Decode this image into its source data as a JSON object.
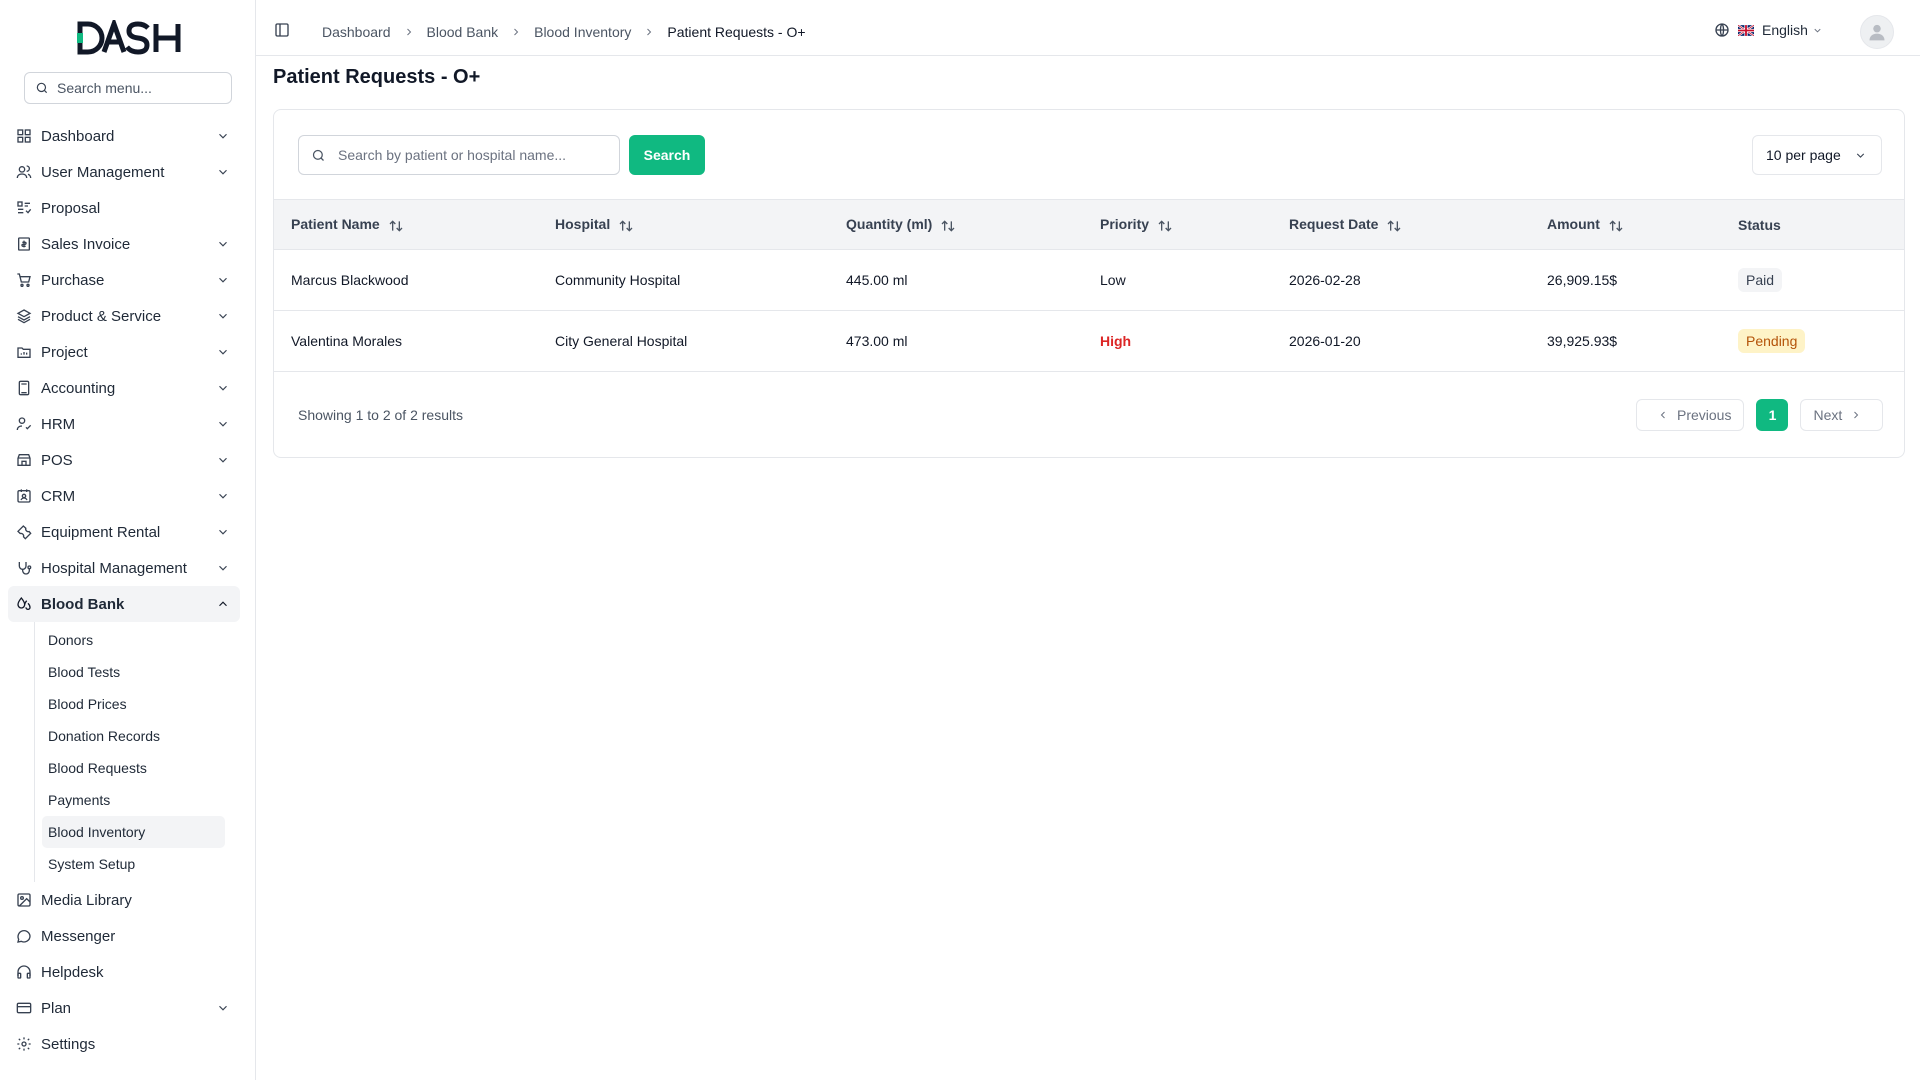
{
  "sidebar": {
    "search_placeholder": "Search menu...",
    "items": [
      {
        "label": "Dashboard",
        "icon": "grid-icon",
        "chevron": true
      },
      {
        "label": "User Management",
        "icon": "users-icon",
        "chevron": true
      },
      {
        "label": "Proposal",
        "icon": "list-icon",
        "chevron": false
      },
      {
        "label": "Sales Invoice",
        "icon": "invoice-icon",
        "chevron": true
      },
      {
        "label": "Purchase",
        "icon": "cart-icon",
        "chevron": true
      },
      {
        "label": "Product & Service",
        "icon": "layers-icon",
        "chevron": true
      },
      {
        "label": "Project",
        "icon": "folder-icon",
        "chevron": true
      },
      {
        "label": "Accounting",
        "icon": "calculator-icon",
        "chevron": true
      },
      {
        "label": "HRM",
        "icon": "hrm-icon",
        "chevron": true
      },
      {
        "label": "POS",
        "icon": "store-icon",
        "chevron": true
      },
      {
        "label": "CRM",
        "icon": "crm-icon",
        "chevron": true
      },
      {
        "label": "Equipment Rental",
        "icon": "wrench-icon",
        "chevron": true
      },
      {
        "label": "Hospital Management",
        "icon": "stethoscope-icon",
        "chevron": true
      },
      {
        "label": "Blood Bank",
        "icon": "blood-drop-icon",
        "chevron": true
      }
    ],
    "blood_bank_sub": [
      "Donors",
      "Blood Tests",
      "Blood Prices",
      "Donation Records",
      "Blood Requests",
      "Payments",
      "Blood Inventory",
      "System Setup"
    ],
    "bottom_items": [
      {
        "label": "Media Library",
        "icon": "image-icon",
        "chevron": false
      },
      {
        "label": "Messenger",
        "icon": "message-icon",
        "chevron": false
      },
      {
        "label": "Helpdesk",
        "icon": "headphones-icon",
        "chevron": false
      },
      {
        "label": "Plan",
        "icon": "card-icon",
        "chevron": true
      },
      {
        "label": "Settings",
        "icon": "gear-icon",
        "chevron": false
      }
    ]
  },
  "header": {
    "breadcrumbs": [
      "Dashboard",
      "Blood Bank",
      "Blood Inventory",
      "Patient Requests - O+"
    ],
    "language": "English"
  },
  "page": {
    "title": "Patient Requests - O+",
    "search_placeholder": "Search by patient or hospital name...",
    "search_button": "Search",
    "per_page": "10 per page"
  },
  "table": {
    "columns": [
      "Patient Name",
      "Hospital",
      "Quantity (ml)",
      "Priority",
      "Request Date",
      "Amount",
      "Status"
    ],
    "rows": [
      {
        "patient": "Marcus Blackwood",
        "hospital": "Community Hospital",
        "quantity": "445.00 ml",
        "priority": "Low",
        "date": "2026-02-28",
        "amount": "26,909.15$",
        "status": "Paid"
      },
      {
        "patient": "Valentina Morales",
        "hospital": "City General Hospital",
        "quantity": "473.00 ml",
        "priority": "High",
        "date": "2026-01-20",
        "amount": "39,925.93$",
        "status": "Pending"
      }
    ]
  },
  "footer": {
    "showing": "Showing 1 to 2 of 2 results",
    "previous": "Previous",
    "page": "1",
    "next": "Next"
  },
  "colors": {
    "accent": "#10b981",
    "high": "#dc2626",
    "pending_bg": "#fef3c7"
  }
}
